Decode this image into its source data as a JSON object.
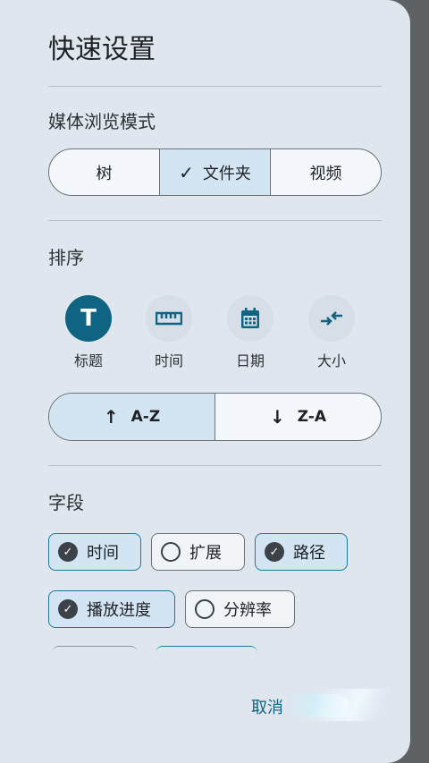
{
  "dialog": {
    "title": "快速设置",
    "media_mode": {
      "label": "媒体浏览模式",
      "options": [
        "树",
        "文件夹",
        "视频"
      ],
      "selected": "文件夹"
    },
    "sort": {
      "label": "排序",
      "options": [
        {
          "label": "标题",
          "icon": "title-icon",
          "selected": true
        },
        {
          "label": "时间",
          "icon": "ruler-icon",
          "selected": false
        },
        {
          "label": "日期",
          "icon": "calendar-icon",
          "selected": false
        },
        {
          "label": "大小",
          "icon": "compress-icon",
          "selected": false
        }
      ],
      "order_options": [
        "A-Z",
        "Z-A"
      ],
      "order_selected": "A-Z"
    },
    "fields": {
      "label": "字段",
      "chips": [
        {
          "label": "时间",
          "checked": true
        },
        {
          "label": "扩展",
          "checked": false
        },
        {
          "label": "路径",
          "checked": true
        },
        {
          "label": "播放进度",
          "checked": true
        },
        {
          "label": "分辨率",
          "checked": false
        }
      ]
    },
    "cancel_label": "取消"
  },
  "colors": {
    "accent": "#0f6383",
    "selected_bg": "#d3e4f3",
    "sheet_bg": "#dfe6ee"
  }
}
